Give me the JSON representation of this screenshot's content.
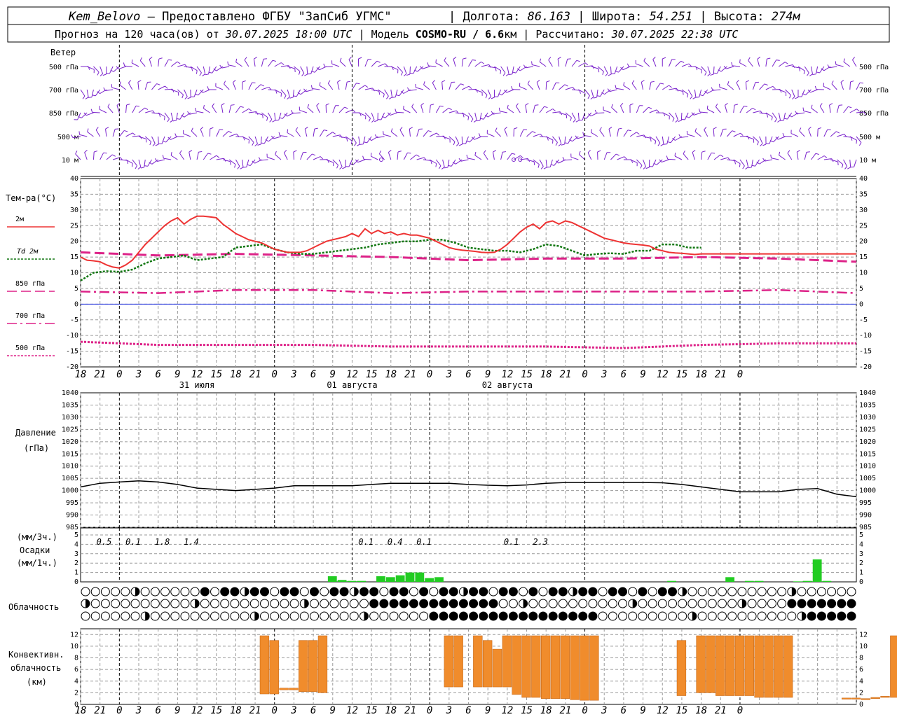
{
  "header": {
    "station": "Kem_Belovo",
    "provider": " – Предоставлено ФГБУ \"ЗапСиб УГМС\"",
    "lon_label": "Долгота:",
    "lon": "86.163",
    "lat_label": "Широта:",
    "lat": "54.251",
    "alt_label": "Высота:",
    "alt": "274м",
    "forecast_prefix": "Прогноз на 120 часа(ов) от",
    "forecast_time": "30.07.2025 18:00 UTC",
    "model_label": "Модель",
    "model": "COSMO-RU / 6.6",
    "model_unit": "км",
    "calc_label": "Рассчитано:",
    "calc_time": "30.07.2025 22:38 UTC"
  },
  "time_axis": {
    "hours": [
      "18",
      "21",
      "0",
      "3",
      "6",
      "9",
      "12",
      "15",
      "18",
      "21",
      "0",
      "3",
      "6",
      "9",
      "12",
      "15",
      "18",
      "21",
      "0",
      "3",
      "6",
      "9",
      "12",
      "15",
      "18",
      "21",
      "0",
      "3",
      "6",
      "9",
      "12",
      "15",
      "18",
      "21",
      "0"
    ],
    "days": [
      "31 июля",
      "01 августа",
      "02 августа"
    ]
  },
  "wind": {
    "title": "Ветер",
    "levels": [
      "500 гПа",
      "700 гПа",
      "850 гПа",
      "500 м",
      "10  м"
    ]
  },
  "temperature": {
    "title": "Тем-ра(°C)",
    "legend": [
      {
        "label": "2м",
        "color": "#ee3333"
      },
      {
        "label": "Td  2м",
        "color": "#117711"
      },
      {
        "label": "850 гПа",
        "color": "#dd2288"
      },
      {
        "label": "700 гПа",
        "color": "#dd2288"
      },
      {
        "label": "500 гПа",
        "color": "#dd2288"
      }
    ],
    "ticks": [
      "40",
      "35",
      "30",
      "25",
      "20",
      "15",
      "10",
      "5",
      "0",
      "-5",
      "-10",
      "-15",
      "-20"
    ]
  },
  "pressure": {
    "title": "Давление",
    "unit": "(гПа)",
    "ticks": [
      "1040",
      "1035",
      "1030",
      "1025",
      "1020",
      "1015",
      "1010",
      "1005",
      "1000",
      "995",
      "990",
      "985"
    ]
  },
  "precip": {
    "unit3": "(мм/3ч.)",
    "title": "Осадки",
    "unit1": "(мм/1ч.)",
    "ticks": [
      "5",
      "4",
      "3",
      "2",
      "1",
      "0"
    ],
    "totals": [
      {
        "hour": 3,
        "text": "0.5"
      },
      {
        "hour": 6,
        "text": "0.1"
      },
      {
        "hour": 9,
        "text": "1.8"
      },
      {
        "hour": 12,
        "text": "1.4"
      },
      {
        "hour": 30,
        "text": "0.1"
      },
      {
        "hour": 33,
        "text": "0.4"
      },
      {
        "hour": 36,
        "text": "0.1"
      },
      {
        "hour": 45,
        "text": "0.1"
      },
      {
        "hour": 48,
        "text": "2.3"
      }
    ]
  },
  "cloud": {
    "title": "Облачность"
  },
  "convective": {
    "title1": "Конвективн.",
    "title2": "облачность",
    "unit": "(км)",
    "ticks": [
      "12",
      "10",
      "8",
      "6",
      "4",
      "2",
      "0"
    ]
  },
  "chart_data": {
    "type": "line",
    "x_unit": "hours from 30.07.2025 18:00 UTC",
    "series": [
      {
        "name": "2м",
        "color": "#ee3333",
        "x": [
          0,
          1,
          2,
          3,
          4,
          5,
          6,
          7,
          8,
          9,
          10,
          11,
          12,
          13,
          14,
          15,
          16,
          17,
          18,
          19,
          20,
          21,
          22,
          23,
          24,
          25,
          26,
          27,
          28,
          29,
          30,
          31,
          32,
          33,
          34,
          35,
          36,
          37,
          38,
          39,
          40,
          41,
          42,
          43,
          44,
          45,
          46,
          47,
          48,
          49,
          50,
          51,
          52,
          53,
          54,
          55,
          56,
          57,
          58,
          59,
          60,
          61,
          62,
          63,
          64,
          65,
          66,
          67,
          68,
          69,
          70,
          71,
          72,
          73,
          74,
          75,
          76,
          77,
          78,
          79,
          80,
          81,
          82,
          83,
          84,
          85,
          86,
          87,
          88,
          89,
          90,
          91,
          92,
          93,
          94,
          95,
          96,
          97,
          98,
          99,
          100,
          101,
          102,
          103,
          104,
          105,
          106,
          107,
          108,
          109,
          110,
          111,
          112,
          113,
          114,
          115,
          116,
          117,
          118,
          119,
          120
        ],
        "y": [
          15,
          14,
          13.8,
          13.5,
          12.5,
          11.8,
          11.5,
          12.5,
          14,
          16.5,
          19,
          21,
          23,
          25,
          26.5,
          27.5,
          25.5,
          27,
          28,
          28,
          27.8,
          27.5,
          25.5,
          24,
          22.5,
          21.5,
          20.5,
          20,
          19.5,
          18.5,
          17.5,
          17,
          16.5,
          16.5,
          16.5,
          17,
          18,
          19,
          20,
          20.5,
          21,
          21.5,
          22.5,
          21.5,
          24,
          22.5,
          23.5,
          22.5,
          23,
          22,
          22.5,
          22,
          22,
          21.5,
          21,
          20,
          19,
          18,
          17.5,
          17.2,
          17,
          16.8,
          16.5,
          16.4,
          16.5,
          17.5,
          19,
          21,
          23,
          24.5,
          25.5,
          24,
          26,
          26.5,
          25.5,
          26.5,
          26,
          25,
          24,
          23,
          22,
          21,
          20.5,
          20,
          19.5,
          19.2,
          19,
          18.8,
          18.5,
          17.5,
          17,
          16.5,
          16.3,
          16.2,
          16,
          15.8,
          16,
          16,
          16,
          16,
          16,
          16,
          16,
          16,
          16,
          16,
          16,
          16,
          16,
          16,
          16,
          16,
          16,
          16,
          16,
          16,
          16,
          16,
          16,
          16,
          16
        ]
      },
      {
        "name": "Td  2м",
        "color": "#117711",
        "x": [
          0,
          2,
          4,
          6,
          8,
          10,
          12,
          14,
          16,
          18,
          20,
          22,
          24,
          26,
          28,
          30,
          32,
          34,
          36,
          38,
          40,
          42,
          44,
          46,
          48,
          50,
          52,
          54,
          56,
          58,
          60,
          62,
          64,
          66,
          68,
          70,
          72,
          74,
          76,
          78,
          80,
          82,
          84,
          86,
          88,
          90,
          92,
          94,
          96
        ],
        "y": [
          7.5,
          10,
          10.5,
          10.3,
          11,
          13,
          14.5,
          15,
          15.5,
          14,
          14.5,
          15,
          18,
          18.5,
          19,
          17.5,
          16.5,
          16,
          16,
          16.5,
          17,
          17.5,
          18,
          19,
          19.5,
          20,
          20,
          20.5,
          20.5,
          19.5,
          18,
          17.5,
          17,
          17,
          16.5,
          17.5,
          19,
          18.5,
          17,
          15.5,
          16,
          16.2,
          16,
          17,
          17,
          19,
          19,
          18,
          18
        ]
      },
      {
        "name": "850 гПа",
        "color": "#dd2288",
        "x": [
          0,
          12,
          24,
          36,
          48,
          60,
          72,
          84,
          96,
          108,
          120
        ],
        "y": [
          16.5,
          15.5,
          16,
          15.5,
          15,
          14,
          14.5,
          14.5,
          15,
          14.5,
          13.5
        ]
      },
      {
        "name": "700 гПа",
        "color": "#dd2288",
        "x": [
          0,
          12,
          24,
          36,
          48,
          60,
          72,
          84,
          96,
          108,
          120
        ],
        "y": [
          4,
          3.5,
          4.5,
          4.5,
          3.5,
          4,
          4,
          4,
          4,
          4.5,
          3.5
        ]
      },
      {
        "name": "500 гПа",
        "color": "#dd2288",
        "x": [
          0,
          12,
          24,
          36,
          48,
          60,
          72,
          84,
          96,
          108,
          120
        ],
        "y": [
          -12,
          -13,
          -13,
          -13,
          -13.5,
          -13.5,
          -13.5,
          -14,
          -13,
          -12.5,
          -12.5
        ]
      },
      {
        "name": "Давление",
        "color": "#000000",
        "x": [
          0,
          3,
          6,
          9,
          12,
          15,
          18,
          21,
          24,
          27,
          30,
          33,
          36,
          39,
          42,
          45,
          48,
          51,
          54,
          57,
          60,
          63,
          66,
          69,
          72,
          75,
          78,
          81,
          84,
          87,
          90,
          93,
          96,
          99,
          102,
          105,
          108,
          111,
          114,
          117,
          120
        ],
        "y": [
          1001.5,
          1003,
          1003.5,
          1004,
          1003.5,
          1002.5,
          1001,
          1000.5,
          1000,
          1000.5,
          1001,
          1002,
          1002,
          1002,
          1002,
          1002.5,
          1003,
          1003,
          1003,
          1003,
          1002.5,
          1002.2,
          1002,
          1002.3,
          1003,
          1003.3,
          1003.3,
          1003.3,
          1003.3,
          1003.3,
          1003.2,
          1002.5,
          1001.5,
          1000.5,
          999.5,
          999.5,
          999.5,
          1000.5,
          1000.8,
          998.5,
          997.5
        ]
      }
    ],
    "precip_bars": [
      {
        "hour": 26,
        "mm": 0.6
      },
      {
        "hour": 27,
        "mm": 0.2
      },
      {
        "hour": 28,
        "mm": 0.1
      },
      {
        "hour": 29,
        "mm": 0.1
      },
      {
        "hour": 31,
        "mm": 0.6
      },
      {
        "hour": 32,
        "mm": 0.5
      },
      {
        "hour": 33,
        "mm": 0.7
      },
      {
        "hour": 34,
        "mm": 1.0
      },
      {
        "hour": 35,
        "mm": 1.0
      },
      {
        "hour": 36,
        "mm": 0.4
      },
      {
        "hour": 37,
        "mm": 0.5
      },
      {
        "hour": 61,
        "mm": 0.1
      },
      {
        "hour": 67,
        "mm": 0.5
      },
      {
        "hour": 69,
        "mm": 0.1
      },
      {
        "hour": 70,
        "mm": 0.1
      },
      {
        "hour": 74,
        "mm": 0.05
      },
      {
        "hour": 75,
        "mm": 0.1
      },
      {
        "hour": 76,
        "mm": 2.4
      },
      {
        "hour": 77,
        "mm": 0.1
      }
    ],
    "convective_bars": [
      {
        "hour": 19,
        "base": 1.8,
        "top": 11.8
      },
      {
        "hour": 20,
        "base": 1.8,
        "top": 11
      },
      {
        "hour": 21,
        "base": 2.5,
        "top": 2.8
      },
      {
        "hour": 22,
        "base": 2.5,
        "top": 2.8
      },
      {
        "hour": 23,
        "base": 2.2,
        "top": 11
      },
      {
        "hour": 24,
        "base": 2.2,
        "top": 11
      },
      {
        "hour": 25,
        "base": 2.0,
        "top": 11.8
      },
      {
        "hour": 38,
        "base": 3,
        "top": 11.8
      },
      {
        "hour": 39,
        "base": 3,
        "top": 11.8
      },
      {
        "hour": 41,
        "base": 3,
        "top": 11.8
      },
      {
        "hour": 42,
        "base": 3,
        "top": 11
      },
      {
        "hour": 43,
        "base": 3,
        "top": 9.5
      },
      {
        "hour": 44,
        "base": 3,
        "top": 11.8
      },
      {
        "hour": 45,
        "base": 1.7,
        "top": 11.8
      },
      {
        "hour": 46,
        "base": 1.2,
        "top": 11.8
      },
      {
        "hour": 47,
        "base": 1.2,
        "top": 11.8
      },
      {
        "hour": 48,
        "base": 1.0,
        "top": 11.8
      },
      {
        "hour": 49,
        "base": 1.0,
        "top": 11.8
      },
      {
        "hour": 50,
        "base": 1.0,
        "top": 11.8
      },
      {
        "hour": 51,
        "base": 0.8,
        "top": 11.8
      },
      {
        "hour": 52,
        "base": 0.7,
        "top": 11.8
      },
      {
        "hour": 53,
        "base": 0.7,
        "top": 11.8
      },
      {
        "hour": 62,
        "base": 1.5,
        "top": 11
      },
      {
        "hour": 64,
        "base": 2,
        "top": 11.8
      },
      {
        "hour": 65,
        "base": 2,
        "top": 11.8
      },
      {
        "hour": 66,
        "base": 1.5,
        "top": 11.8
      },
      {
        "hour": 67,
        "base": 1.5,
        "top": 11.8
      },
      {
        "hour": 68,
        "base": 1.5,
        "top": 11.8
      },
      {
        "hour": 69,
        "base": 1.5,
        "top": 11.8
      },
      {
        "hour": 70,
        "base": 1.2,
        "top": 11.8
      },
      {
        "hour": 71,
        "base": 1.2,
        "top": 11.8
      },
      {
        "hour": 72,
        "base": 1.2,
        "top": 11.8
      },
      {
        "hour": 73,
        "base": 1.2,
        "top": 11.8
      },
      {
        "hour": 79,
        "base": 0.9,
        "top": 1.1
      },
      {
        "hour": 80,
        "base": 0.9,
        "top": 1.1
      },
      {
        "hour": 81,
        "base": 0.8,
        "top": 1.0
      },
      {
        "hour": 82,
        "base": 1.0,
        "top": 1.2
      },
      {
        "hour": 83,
        "base": 1.2,
        "top": 1.4
      },
      {
        "hour": 84,
        "base": 1.2,
        "top": 11.8
      },
      {
        "hour": 85,
        "base": 0.9,
        "top": 1.1
      }
    ]
  }
}
